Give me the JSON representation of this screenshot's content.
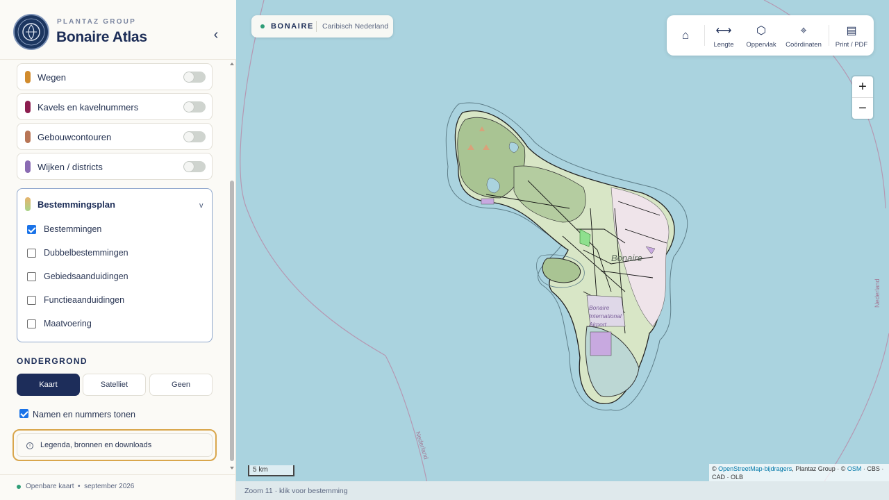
{
  "brand": {
    "subtitle": "PLANTAZ GROUP",
    "title": "Bonaire Atlas",
    "collapse_glyph": "‹"
  },
  "layers": [
    {
      "label": "Wegen",
      "color": "#d18b2d",
      "on": false
    },
    {
      "label": "Kavels en kavelnummers",
      "color": "#8c1d4f",
      "on": false
    },
    {
      "label": "Gebouwcontouren",
      "color": "#b87556",
      "on": false
    },
    {
      "label": "Wijken / districts",
      "color": "#8a6bb3",
      "on": false
    }
  ],
  "zoning": {
    "title": "Bestemmingsplan",
    "chevron": "v",
    "options": [
      {
        "label": "Bestemmingen",
        "checked": true
      },
      {
        "label": "Dubbelbestemmingen",
        "checked": false
      },
      {
        "label": "Gebiedsaanduidingen",
        "checked": false
      },
      {
        "label": "Functieaanduidingen",
        "checked": false
      },
      {
        "label": "Maatvoering",
        "checked": false
      }
    ]
  },
  "basemap": {
    "heading": "ONDERGROND",
    "options": [
      "Kaart",
      "Satelliet",
      "Geen"
    ],
    "selected": "Kaart"
  },
  "names_toggle": {
    "label": "Namen en nummers tonen",
    "checked": true
  },
  "legend_link": {
    "label": "Legenda, bronnen en downloads",
    "icon": "info-icon"
  },
  "footer": {
    "text": "Openbare kaart  •  september 2026"
  },
  "map": {
    "chip": {
      "name": "BONAIRE",
      "subtitle": "Caribisch Nederland"
    },
    "tools": [
      {
        "name": "home-icon",
        "glyph": "⌂",
        "label": ""
      },
      {
        "name": "length-icon",
        "glyph": "⟷",
        "label": "Lengte"
      },
      {
        "name": "area-icon",
        "glyph": "⬡",
        "label": "Oppervlak"
      },
      {
        "name": "coordinates-icon",
        "glyph": "⌖",
        "label": "Coördinaten"
      },
      {
        "name": "print-icon",
        "glyph": "▤",
        "label": "Print / PDF"
      }
    ],
    "zoom_in": "+",
    "zoom_out": "−",
    "scale": "5 km",
    "attribution": {
      "prefix": "© ",
      "link1": "OpenStreetMap-bijdragers",
      "middle": ", Plantaz Group · © ",
      "link2": "OSM",
      "suffix": " · CBS · CAD · OLB"
    },
    "status": "Zoom 11 · klik voor bestemming",
    "labels": {
      "boundary_right": "Nederland",
      "boundary_bottom": "Nederland",
      "island_name": "Bonaire",
      "airport": "Bonaire International Airport"
    }
  },
  "colors": {
    "accent": "#1d2d5a",
    "sea": "#aad3df",
    "highlight_border": "#d9a64c",
    "status_green": "#2e9d77"
  }
}
